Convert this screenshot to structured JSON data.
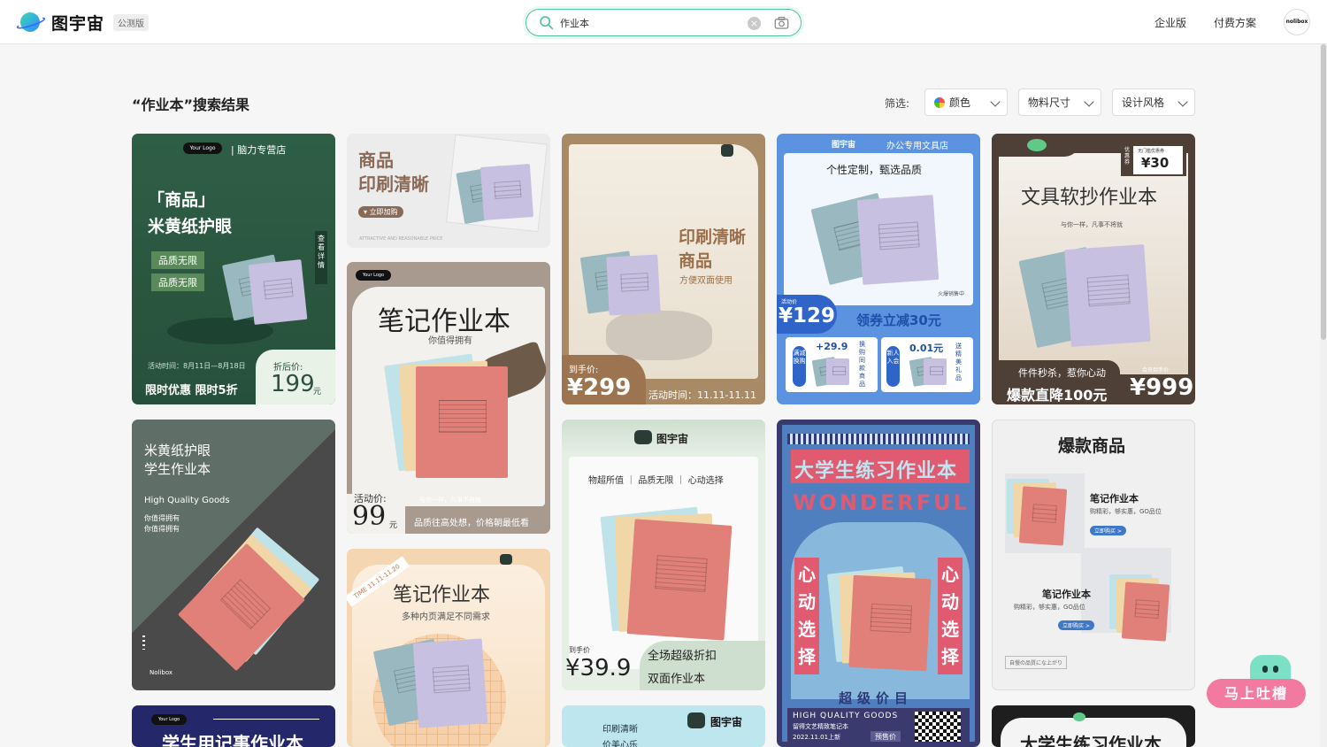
{
  "header": {
    "logo_text": "图宇宙",
    "beta_badge": "公测版",
    "search_value": "作业本",
    "nav": [
      "企业版",
      "付费方案"
    ],
    "avatar_text": "nolibox"
  },
  "results": {
    "title": "“作业本”搜索结果",
    "filter_label": "筛选:",
    "filters": [
      "颜色",
      "物料尺寸",
      "设计风格"
    ]
  },
  "cards": {
    "c1": {
      "brand": "Your Logo",
      "store": "| 脑力专营店",
      "line1": "「商品」",
      "line2": "米黄纸护眼",
      "tag1": "品质无限",
      "tag2": "品质无限",
      "side": "查看详情",
      "date": "活动时间：8月11日—8月18日",
      "promo": "限时优惠 限时5折",
      "after_label": "折后价:",
      "price": "199",
      "unit": "元"
    },
    "c2": {
      "line1": "商品",
      "line2": "印刷清晰",
      "btn": "立即加购",
      "footer": "ATTRACTIVE AND REASONABLE PRICE"
    },
    "c3": {
      "title": "印刷清晰",
      "sub": "商品",
      "desc": "方便双面使用",
      "price_label": "到手价:",
      "price": "¥299",
      "date": "活动时间：11.11-11.11"
    },
    "c4": {
      "brand": "图宇宙",
      "store": "办公专用文具店",
      "slogan": "个性定制，甄选品质",
      "fire": "火爆销售中",
      "act": "活动价",
      "price": "¥129",
      "coupon": "领券立减30元",
      "s1_side": "满减换购",
      "s1_price": "+29.9",
      "s1_text": "换购同款商品",
      "s2_side": "新人入会",
      "s2_price": "0.01元",
      "s2_text": "送精美礼品"
    },
    "c5": {
      "corner_small": "优惠券",
      "corner_tag": "无门槛优惠券",
      "corner_price": "¥30",
      "title": "文具软抄作业本",
      "sub": "与你一样，凡事不将就",
      "flash": "件件秒杀，惹你心动",
      "drop": "爆款直降100元",
      "member": "会员到手价",
      "price": "¥999"
    },
    "c6": {
      "brand": "Your Logo",
      "title": "笔记作业本",
      "sub": "你值得拥有",
      "price_label": "活动价:",
      "price": "99",
      "unit": "元",
      "slogan1": "与你一样，凡事不将就",
      "slogan2": "品质往高处想，价格朝最低看"
    },
    "c7": {
      "line1": "米黄纸护眼",
      "line2": "学生作业本",
      "en": "High Quality Goods",
      "s1": "你值得拥有",
      "s2": "你值得拥有",
      "brand": "Nolibox"
    },
    "c8": {
      "stamp": "TIME 11.11-11.20",
      "title": "笔记作业本",
      "sub": "多种内页满足不同需求"
    },
    "c9": {
      "brand": "图宇宙",
      "slogan": "物超所值 ｜ 品质无限 ｜ 心动选择",
      "price_label": "到手价",
      "price": "¥39.9",
      "promo": "全场超级折扣",
      "product": "双面作业本"
    },
    "c10": {
      "title": "大学生练习作业本",
      "en": "WONDERFUL",
      "left": "心动选择",
      "right": "心动选择",
      "bottom": "超级价目",
      "foot_en": "HIGH QUALITY GOODS",
      "foot1": "留得文艺精致笔记本",
      "foot2": "2022.11.01上新",
      "btn": "预售价"
    },
    "c11": {
      "title": "爆款商品",
      "p1": "笔记作业本",
      "p1d": "购精彩，够实惠，GO品位",
      "b1": "立即购买 >",
      "p2": "笔记作业本",
      "p2d": "购精彩，够实惠，GO品位",
      "b2": "立即购买 >",
      "foot": "自慢の品質にな上がり"
    },
    "c12": {
      "brand": "Your Logo",
      "title": "学生用记事作业本"
    },
    "c13": {
      "t1": "印刷清晰",
      "t2": "价美心乐",
      "brand": "图宇宙"
    },
    "c14": {
      "title": "大学生练习作业本"
    }
  },
  "feedback": {
    "label": "马上吐槽"
  },
  "colors": {
    "accent": "#4fc3a1",
    "feedback": "#f27aa0"
  }
}
